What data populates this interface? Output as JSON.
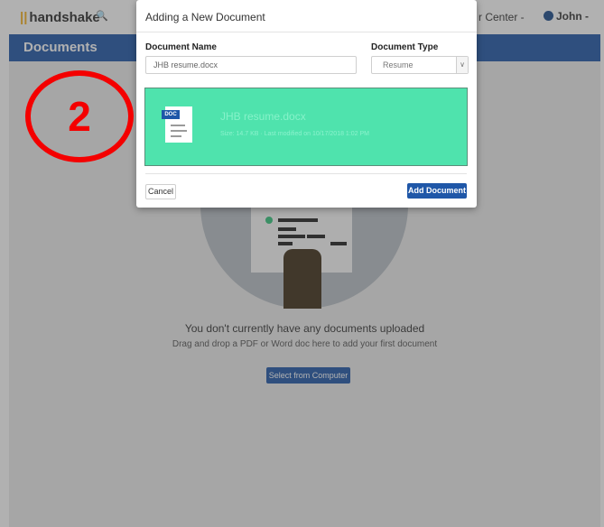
{
  "topbar": {
    "logo_mark": "||",
    "logo_text": "handshake",
    "search_icon": "search-icon",
    "career_center": "r Center -",
    "user": "John -"
  },
  "docbar": {
    "title": "Documents"
  },
  "empty_state": {
    "title": "You don't currently have any documents uploaded",
    "subtitle": "Drag and drop a PDF or Word doc here to add your first document",
    "select_button": "Select from Computer"
  },
  "modal": {
    "title": "Adding a New Document",
    "document_name_label": "Document Name",
    "document_name_value": "JHB resume.docx",
    "document_type_label": "Document Type",
    "document_type_value": "Resume",
    "dropzone": {
      "file_icon_tag": "DOC",
      "file_name": "JHB resume.docx",
      "file_meta": "Size: 14.7 KB · Last modified on 10/17/2018 1:02 PM"
    },
    "cancel_label": "Cancel",
    "add_label": "Add Document"
  },
  "annotation": {
    "number": "2",
    "color": "#f40000"
  },
  "colors": {
    "brand_blue": "#1f57a8",
    "dropzone_green": "#4fe3ad",
    "logo_yellow": "#f4b01e"
  }
}
